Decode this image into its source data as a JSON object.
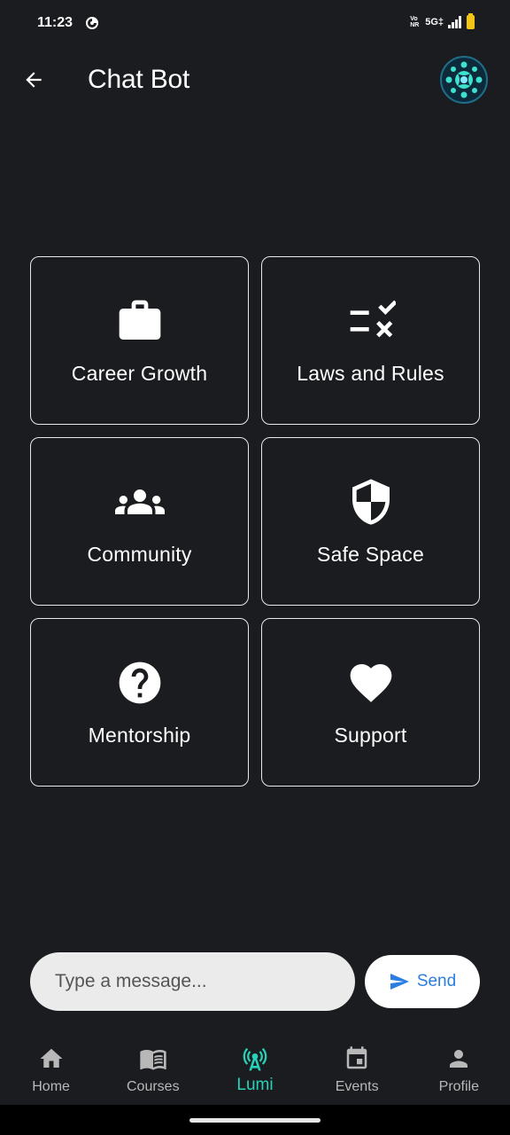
{
  "status_bar": {
    "time": "11:23",
    "network_label": "Vo NR",
    "signal_label": "5G‡",
    "battery_color": "#f4c514"
  },
  "app_bar": {
    "title": "Chat Bot",
    "back_icon": "arrow-left-icon",
    "avatar_icon": "app-logo-avatar"
  },
  "topics": [
    {
      "label": "Career Growth",
      "icon": "briefcase-icon"
    },
    {
      "label": "Laws and Rules",
      "icon": "rule-check-icon"
    },
    {
      "label": "Community",
      "icon": "groups-icon"
    },
    {
      "label": "Safe Space",
      "icon": "shield-icon"
    },
    {
      "label": "Mentorship",
      "icon": "help-circle-icon"
    },
    {
      "label": "Support",
      "icon": "heart-icon"
    }
  ],
  "composer": {
    "placeholder": "Type a message...",
    "value": "",
    "send_label": "Send",
    "send_icon": "send-icon"
  },
  "bottom_nav": {
    "items": [
      {
        "label": "Home",
        "icon": "home-icon"
      },
      {
        "label": "Courses",
        "icon": "book-icon"
      },
      {
        "label": "Lumi",
        "icon": "broadcast-icon",
        "active": true
      },
      {
        "label": "Events",
        "icon": "calendar-icon"
      },
      {
        "label": "Profile",
        "icon": "person-icon"
      }
    ]
  },
  "colors": {
    "background": "#1b1c20",
    "accent": "#27d3b8",
    "send_text": "#2a7de1",
    "input_bg": "#ebebeb"
  }
}
